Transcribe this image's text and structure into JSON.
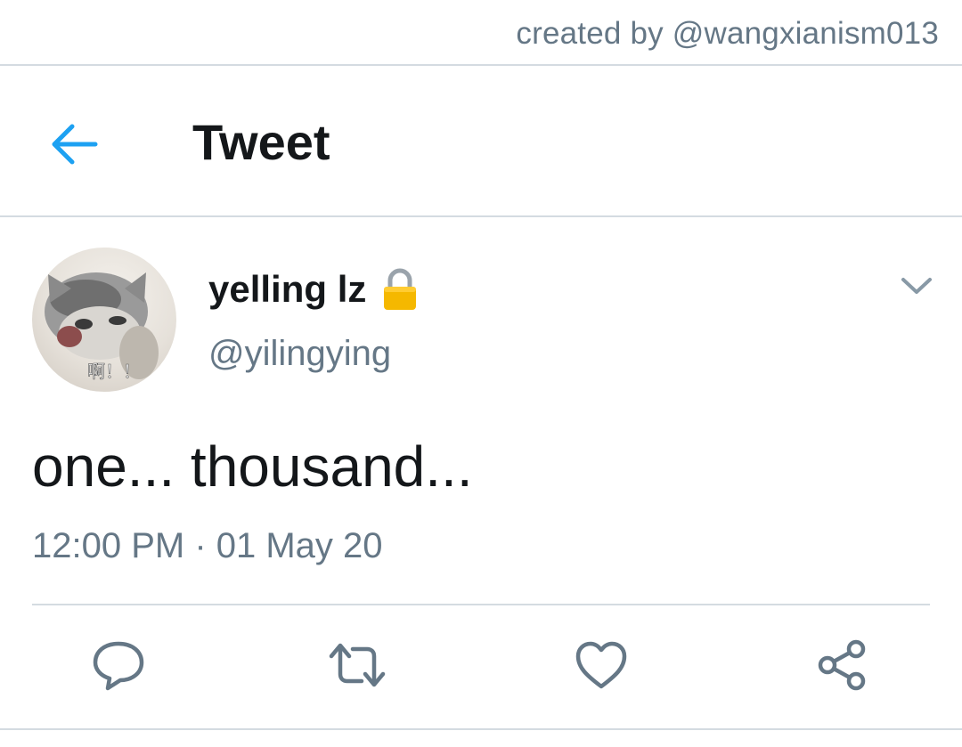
{
  "watermark": "created by @wangxianism013",
  "header": {
    "back_icon": "arrow-left-icon",
    "title": "Tweet"
  },
  "tweet": {
    "author": {
      "display_name": "yelling lz",
      "handle": "@yilingying",
      "protected_icon": "lock-icon",
      "avatar_caption": "啊！！"
    },
    "menu_icon": "chevron-down-icon",
    "text": "one... thousand...",
    "timestamp": "12:00 PM · 01 May 20"
  },
  "actions": [
    {
      "icon": "reply-icon"
    },
    {
      "icon": "retweet-icon"
    },
    {
      "icon": "like-icon"
    },
    {
      "icon": "share-icon"
    }
  ],
  "colors": {
    "accent": "#1da1f2",
    "text": "#14171a",
    "secondary_text": "#657786",
    "divider": "#d4dbe1",
    "lock": "#f5b800"
  }
}
